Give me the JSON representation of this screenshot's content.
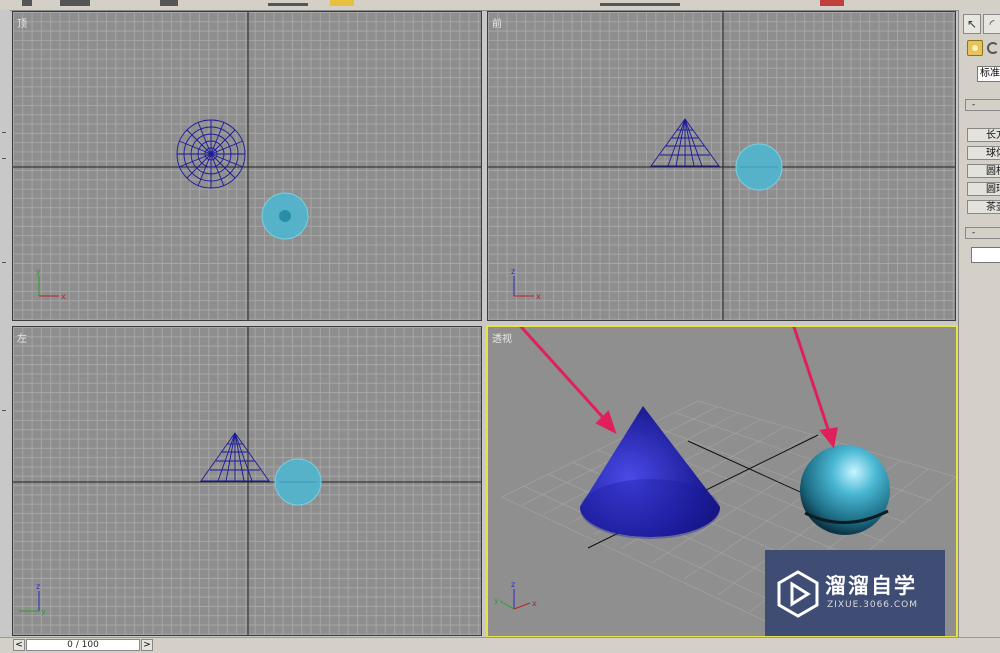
{
  "viewports": {
    "top": {
      "label": "顶"
    },
    "front": {
      "label": "前"
    },
    "left": {
      "label": "左"
    },
    "perspective": {
      "label": "透视"
    }
  },
  "axes": {
    "x": "x",
    "y": "y",
    "z": "z"
  },
  "right_panel": {
    "category": "标准",
    "roll_marker_1": "-",
    "roll_marker_2": "-",
    "object_types": [
      "长方体",
      "球体",
      "圆柱体",
      "圆环",
      "茶壶"
    ]
  },
  "timeline": {
    "frame_text": "0 / 100",
    "prev": "<",
    "next": ">"
  },
  "watermark": {
    "name": "溜溜自学",
    "url": "ZIXUE.3066.COM"
  },
  "colors": {
    "wire_blue": "#1a1a9a",
    "sphere_cyan": "#4aa8c4",
    "arrow": "#e0205a",
    "active_border": "#e8e24a"
  }
}
